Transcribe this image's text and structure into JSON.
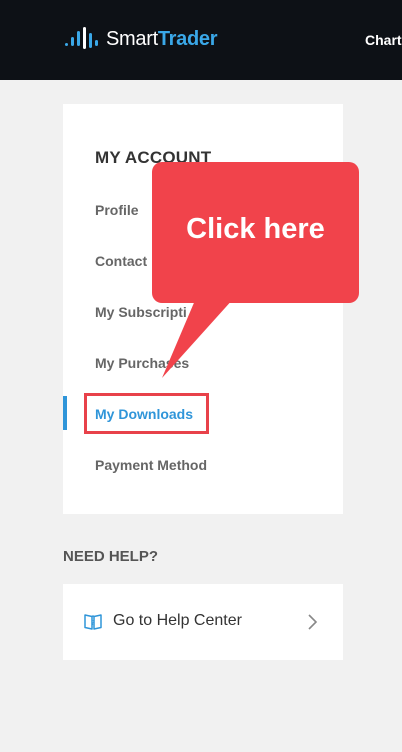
{
  "header": {
    "logo_word1": "Smart",
    "logo_word2": "Trader",
    "nav_item": "Chart"
  },
  "account": {
    "title": "MY ACCOUNT",
    "items": [
      {
        "label": "Profile"
      },
      {
        "label": "Contact"
      },
      {
        "label": "My Subscripti"
      },
      {
        "label": "My Purchases"
      },
      {
        "label": "My Downloads",
        "active": true
      },
      {
        "label": "Payment Method"
      }
    ]
  },
  "callout": {
    "text": "Click here"
  },
  "help": {
    "heading": "NEED HELP?",
    "link_label": "Go to Help Center",
    "icon": "book-question-icon"
  },
  "colors": {
    "topbar": "#0d1116",
    "accent": "#2f95d9",
    "callout": "#f1434b",
    "highlight": "#e8414a"
  }
}
